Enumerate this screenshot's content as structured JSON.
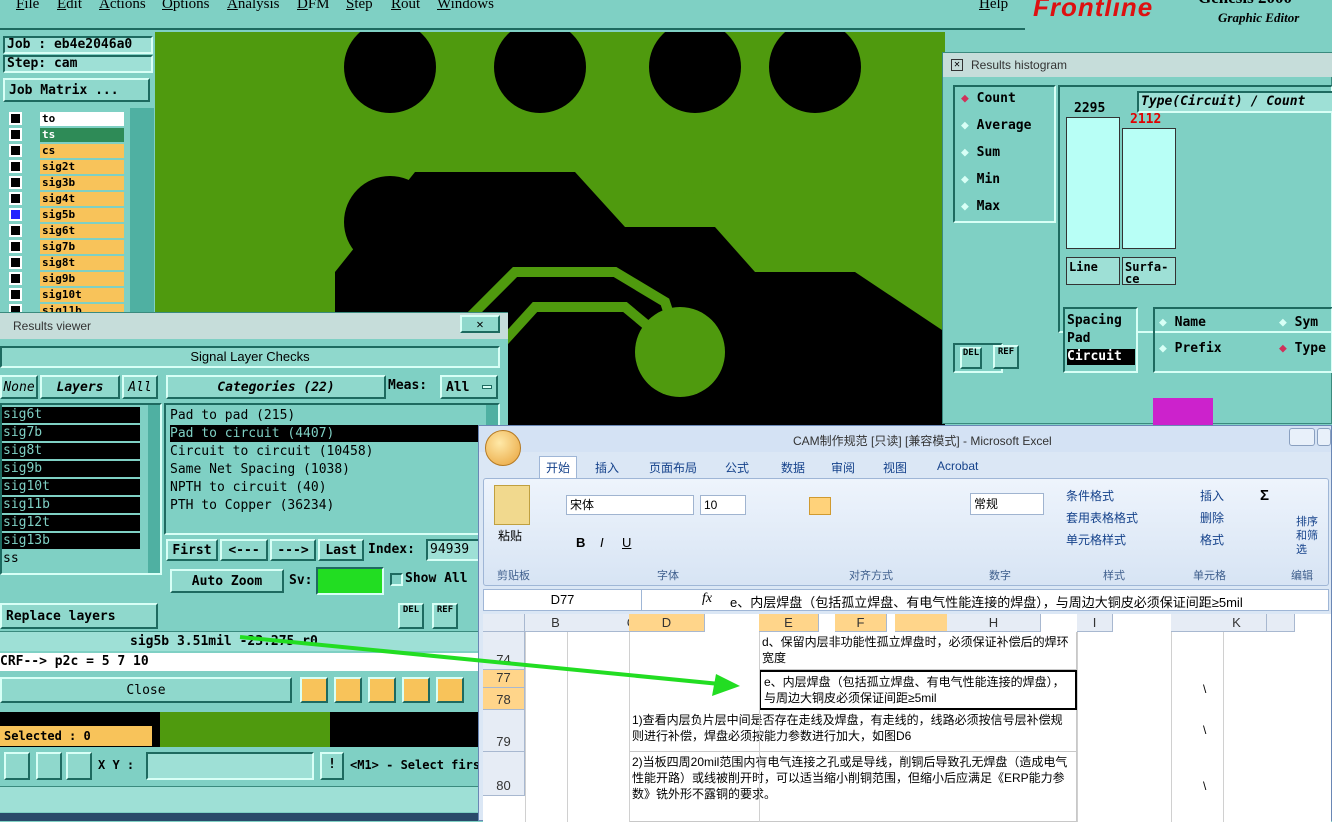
{
  "menubar": {
    "items": [
      "File",
      "Edit",
      "Actions",
      "Options",
      "Analysis",
      "DFM",
      "Step",
      "Rout",
      "Windows"
    ],
    "help": "Help",
    "brand": "Frontline",
    "brand_sub": "Graphic Editor",
    "brand_top": "Genesis 2000"
  },
  "job": {
    "job_label": "Job : eb4e2046a0",
    "step_label": "Step: cam",
    "matrix_button": "Job Matrix ..."
  },
  "layers": [
    {
      "name": "to",
      "color": "#ffffff"
    },
    {
      "name": "ts",
      "color": "#2e8b57"
    },
    {
      "name": "cs",
      "color": "#f8c35a"
    },
    {
      "name": "sig2t",
      "color": "#f8c35a"
    },
    {
      "name": "sig3b",
      "color": "#f8c35a"
    },
    {
      "name": "sig4t",
      "color": "#f8c35a"
    },
    {
      "name": "sig5b",
      "color": "#f8c35a"
    },
    {
      "name": "sig6t",
      "color": "#f8c35a"
    },
    {
      "name": "sig7b",
      "color": "#f8c35a"
    },
    {
      "name": "sig8t",
      "color": "#f8c35a"
    },
    {
      "name": "sig9b",
      "color": "#f8c35a"
    },
    {
      "name": "sig10t",
      "color": "#f8c35a"
    },
    {
      "name": "sig11b",
      "color": "#f8c35a"
    }
  ],
  "results_viewer": {
    "title": "Results viewer",
    "header": "Signal Layer Checks",
    "none_btn": "None",
    "layers_btn": "Layers",
    "all_btn": "All",
    "layer_rows": [
      "sig6t",
      "sig7b",
      "sig8t",
      "sig9b",
      "sig10t",
      "sig11b",
      "sig12t",
      "sig13b",
      "ss"
    ],
    "categories_btn": "Categories (22)",
    "meas_label": "Meas:",
    "meas_value": "All",
    "categories": [
      "Pad to pad (215)",
      "Pad to circuit (4407)",
      "Circuit to circuit (10458)",
      "Same Net Spacing (1038)",
      "NPTH to circuit (40)",
      "PTH to Copper (36234)"
    ],
    "selected_category_index": 1,
    "first_btn": "First",
    "prev_btn": "<---",
    "next_btn": "--->",
    "last_btn": "Last",
    "index_label": "Index:",
    "index_value": "94939",
    "auto_zoom": "Auto Zoom",
    "sv_label": "Sv:",
    "show_all": "Show All",
    "replace_layers": "Replace layers",
    "status_line": "sig5b 3.51mil   -23.275  r0",
    "crf_line": "CRF--> p2c = 5 7 10",
    "close_btn": "Close",
    "del_label": "DEL",
    "ref_label": "REF"
  },
  "bottom_status": {
    "selected": "Selected : 0",
    "xy_label": "X Y :",
    "hint": "<M1> - Select firs"
  },
  "histogram": {
    "title": "Results histogram",
    "modes": [
      "Count",
      "Average",
      "Sum",
      "Min",
      "Max"
    ],
    "selected_mode": "Count",
    "type_label": "Type(Circuit) / Count",
    "bars": [
      {
        "label": "Line",
        "value": 2295,
        "value_text": "2295",
        "value_color": "#000000"
      },
      {
        "label": "Surfa-ce",
        "value": 2112,
        "value_text": "2112",
        "value_color": "#e00000"
      }
    ],
    "list_items": [
      "Spacing",
      "Pad",
      "Circuit"
    ],
    "selected_list_item": "Circuit",
    "group_options": [
      "Name",
      "Sym",
      "Prefix",
      "Type"
    ],
    "selected_group_option": "Type",
    "del_label": "DEL",
    "ref_label": "REF"
  },
  "excel": {
    "title": "CAM制作规范  [只读]  [兼容模式] - Microsoft Excel",
    "tabs": [
      "开始",
      "插入",
      "页面布局",
      "公式",
      "数据",
      "审阅",
      "视图",
      "Acrobat"
    ],
    "active_tab": "开始",
    "paste_label": "粘贴",
    "font_name": "宋体",
    "font_size": "10",
    "number_format": "常规",
    "groups": [
      "剪贴板",
      "字体",
      "对齐方式",
      "数字",
      "样式",
      "单元格",
      "编辑"
    ],
    "style_buttons": [
      "条件格式",
      "套用表格格式",
      "单元格样式"
    ],
    "cell_buttons": [
      "插入",
      "删除",
      "格式"
    ],
    "edit_buttons": [
      "排序和筛选"
    ],
    "name_box": "D77",
    "fx": "fx",
    "formula": "e、内层焊盘（包括孤立焊盘、有电气性能连接的焊盘），与周边大铜皮必须保证间距≥5mil",
    "columns": [
      "A",
      "B",
      "C",
      "D",
      "E",
      "F",
      "G",
      "H",
      "I",
      "J",
      "K"
    ],
    "rows": [
      {
        "num": "74",
        "text": "d、保留内层非功能性孤立焊盘时，必须保证补偿后的焊环宽度",
        "mark": ""
      },
      {
        "num": "77",
        "text": "e、内层焊盘（包括孤立焊盘、有电气性能连接的焊盘），与周边大铜皮必须保证间距≥5mil",
        "mark": "\\"
      },
      {
        "num": "78",
        "text": "",
        "mark": ""
      },
      {
        "num": "79",
        "text": "1)查看内层负片层中间是否存在走线及焊盘，有走线的，线路必须按信号层补偿规则进行补偿，焊盘必须按能力参数进行加大，如图D6",
        "mark": "\\"
      },
      {
        "num": "80",
        "text": "2)当板四周20mil范围内有电气连接之孔或是导线，削铜后导致孔无焊盘（造成电气性能开路）或线被削开时，可以适当缩小削铜范围，但缩小后应满足《ERP能力参数》铣外形不露铜的要求。",
        "mark": "\\"
      }
    ]
  },
  "colors": {
    "panel": "#7fd0c4",
    "copper": "#4f9a0e",
    "layer_active": "#f8c35a",
    "arrow": "#22dd22"
  }
}
